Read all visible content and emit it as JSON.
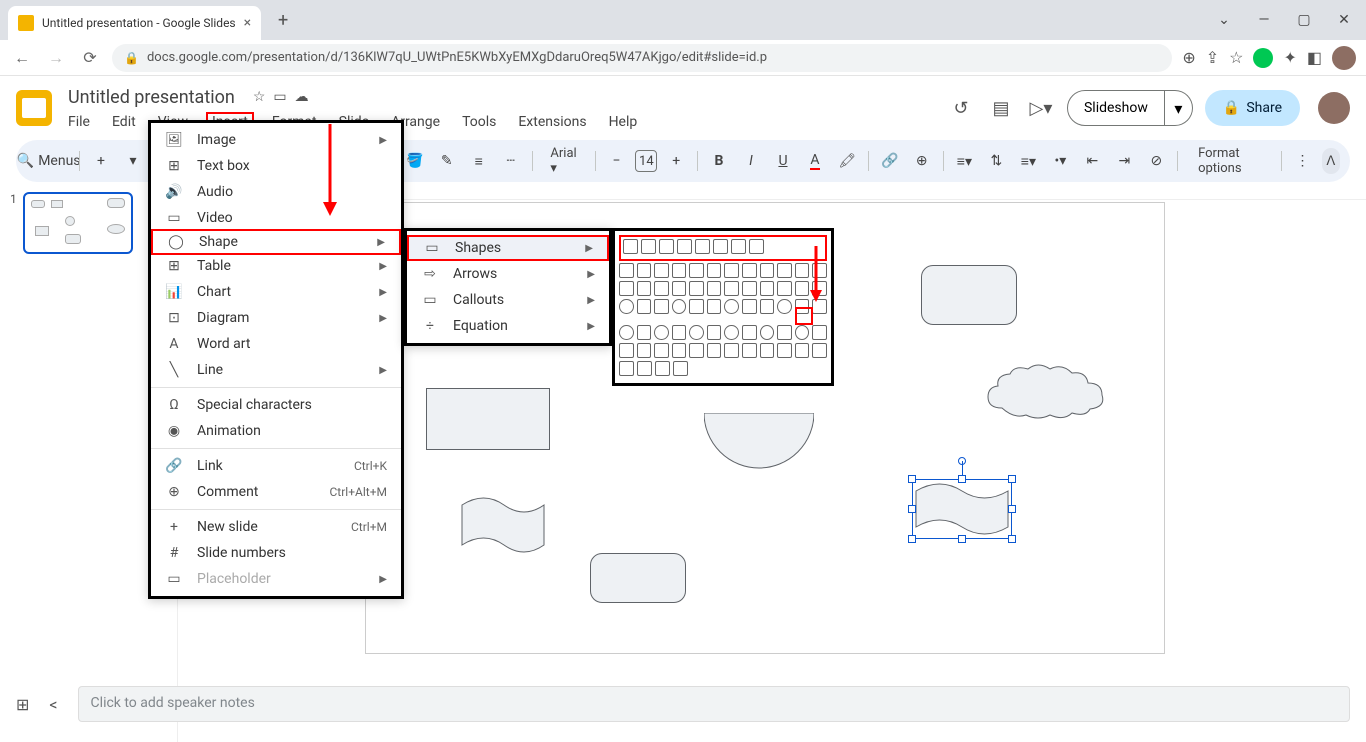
{
  "browser": {
    "tab_title": "Untitled presentation - Google Slides",
    "url": "docs.google.com/presentation/d/136KlW7qU_UWtPnE5KWbXyEMXgDdaruOreq5W47AKjgo/edit#slide=id.p"
  },
  "doc": {
    "title": "Untitled presentation"
  },
  "menubar": {
    "items": [
      "File",
      "Edit",
      "View",
      "Insert",
      "Format",
      "Slide",
      "Arrange",
      "Tools",
      "Extensions",
      "Help"
    ],
    "highlighted_index": 3
  },
  "header": {
    "slideshow": "Slideshow",
    "share": "Share"
  },
  "toolbar": {
    "menus_label": "Menus",
    "font": "Arial",
    "font_size": "14",
    "format_options": "Format options"
  },
  "insert_menu": {
    "items": [
      {
        "icon": "🖼",
        "label": "Image",
        "arrow": true
      },
      {
        "icon": "⊞",
        "label": "Text box"
      },
      {
        "icon": "🔊",
        "label": "Audio"
      },
      {
        "icon": "▭",
        "label": "Video"
      },
      {
        "icon": "◯",
        "label": "Shape",
        "arrow": true,
        "highlighted": true
      },
      {
        "icon": "⊞",
        "label": "Table",
        "arrow": true
      },
      {
        "icon": "📊",
        "label": "Chart",
        "arrow": true
      },
      {
        "icon": "⊡",
        "label": "Diagram",
        "arrow": true
      },
      {
        "icon": "A",
        "label": "Word art"
      },
      {
        "icon": "╲",
        "label": "Line",
        "arrow": true
      },
      {
        "divider": true
      },
      {
        "icon": "Ω",
        "label": "Special characters"
      },
      {
        "icon": "◉",
        "label": "Animation"
      },
      {
        "divider": true
      },
      {
        "icon": "🔗",
        "label": "Link",
        "shortcut": "Ctrl+K"
      },
      {
        "icon": "⊕",
        "label": "Comment",
        "shortcut": "Ctrl+Alt+M"
      },
      {
        "divider": true
      },
      {
        "icon": "+",
        "label": "New slide",
        "shortcut": "Ctrl+M"
      },
      {
        "icon": "#",
        "label": "Slide numbers"
      },
      {
        "icon": "▭",
        "label": "Placeholder",
        "arrow": true,
        "disabled": true
      }
    ]
  },
  "shape_submenu": {
    "items": [
      {
        "icon": "▭",
        "label": "Shapes",
        "arrow": true,
        "highlighted": true
      },
      {
        "icon": "⇨",
        "label": "Arrows",
        "arrow": true
      },
      {
        "icon": "▭",
        "label": "Callouts",
        "arrow": true
      },
      {
        "icon": "÷",
        "label": "Equation",
        "arrow": true
      }
    ]
  },
  "thumb": {
    "number": "1"
  },
  "notes": {
    "placeholder": "Click to add speaker notes"
  }
}
